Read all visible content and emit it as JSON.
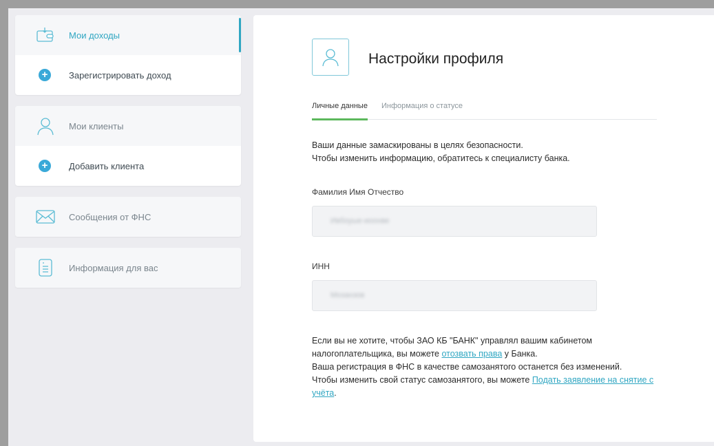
{
  "sidebar": {
    "income": {
      "label": "Мои доходы",
      "action": "Зарегистрировать доход"
    },
    "clients": {
      "label": "Мои клиенты",
      "action": "Добавить клиента"
    },
    "messages": {
      "label": "Сообщения от ФНС"
    },
    "info": {
      "label": "Информация для вас"
    }
  },
  "main": {
    "title": "Настройки профиля",
    "tabs": [
      {
        "label": "Личные данные",
        "active": true
      },
      {
        "label": "Информация о статусе",
        "active": false
      }
    ],
    "notice": {
      "line1": "Ваши данные замаскированы в целях безопасности.",
      "line2": "Чтобы изменить информацию, обратитесь к специалисту банка."
    },
    "fields": {
      "fio_label": "Фамилия Имя Отчество",
      "fio_value": "Ивбоуые-иоонве",
      "inn_label": "ИНН",
      "inn_value": "Мозанзов"
    },
    "footer": {
      "p1_before": "Если вы не хотите, чтобы ЗАО КБ \"БАНК\" управлял вашим кабинетом налогоплательщика, вы можете ",
      "p1_link": "отозвать права",
      "p1_after": " у Банка.",
      "p2": "Ваша регистрация в ФНС в качестве самозанятого останется без изменений.",
      "p3_before": "Чтобы изменить свой статус самозанятого, вы можете ",
      "p3_link": "Подать заявление на снятие с учёта",
      "p3_after": "."
    }
  },
  "colors": {
    "accent": "#2fa6c2",
    "tab_active": "#5cb85c",
    "plus": "#3aa9d8"
  }
}
